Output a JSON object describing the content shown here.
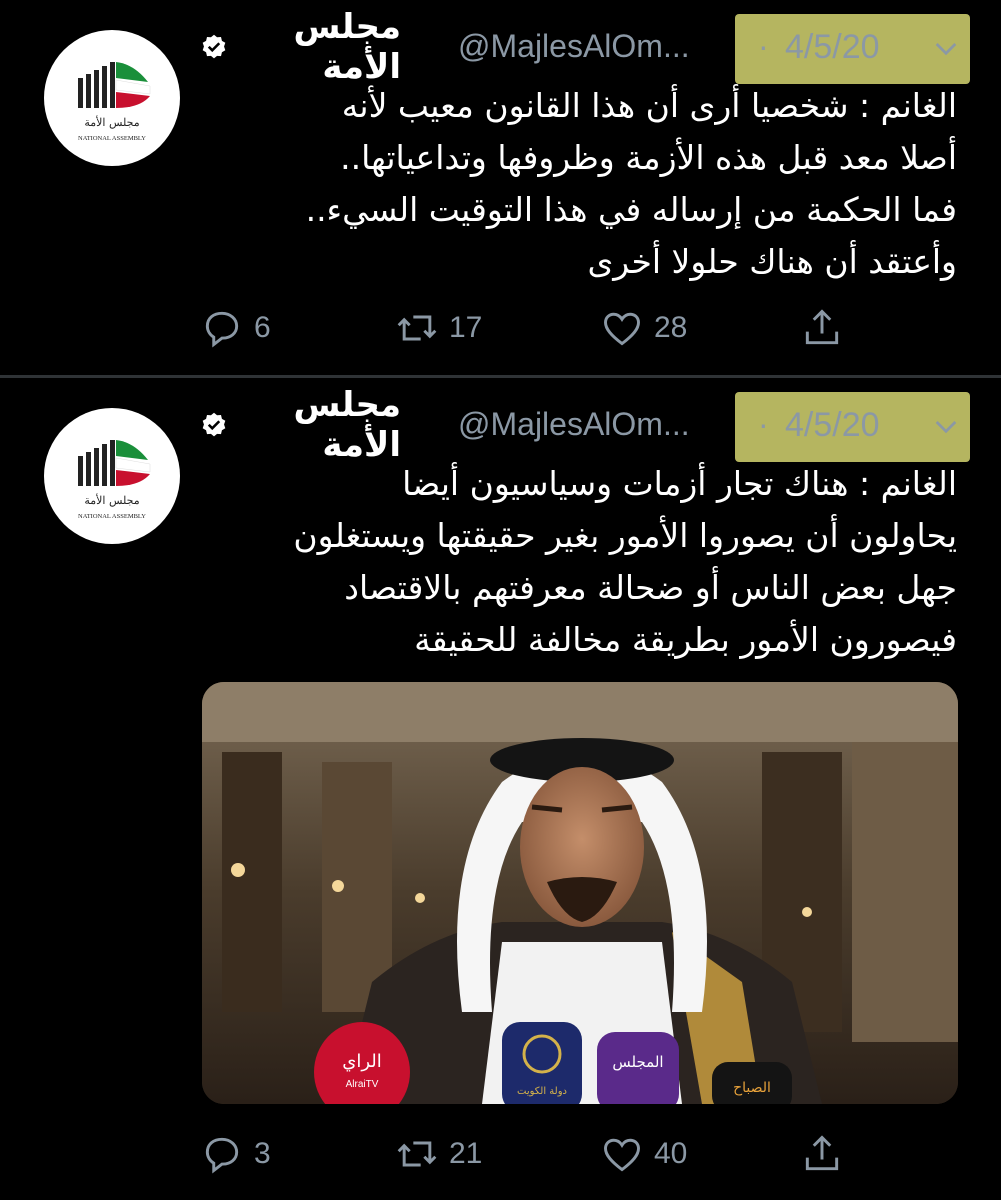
{
  "tweets": [
    {
      "author": {
        "display_name": "مجلس الأمة",
        "handle": "@MajlesAlOm...",
        "verified": true,
        "avatar_caption": "NATIONAL ASSEMBLY"
      },
      "timestamp": "4/5/20",
      "separator": "·",
      "text_lines": [
        "الغانم : شخصيا أرى أن هذا القانون معيب لأنه",
        "أصلا معد قبل هذه الأزمة وظروفها وتداعياتها..",
        "فما الحكمة من إرساله في هذا التوقيت السيء..",
        "وأعتقد أن هناك حلولا أخرى"
      ],
      "counts": {
        "replies": "6",
        "retweets": "17",
        "likes": "28"
      }
    },
    {
      "author": {
        "display_name": "مجلس الأمة",
        "handle": "@MajlesAlOm...",
        "verified": true,
        "avatar_caption": "NATIONAL ASSEMBLY"
      },
      "timestamp": "4/5/20",
      "separator": "·",
      "text_lines": [
        "الغانم : هناك تجار أزمات وسياسيون أيضا",
        "يحاولون أن يصوروا الأمور بغير حقيقتها ويستغلون",
        "جهل بعض الناس أو ضحالة معرفتهم بالاقتصاد",
        "فيصورون الأمور بطريقة مخالفة للحقيقة"
      ],
      "media": {
        "mic_labels": [
          "الراي",
          "AlraiTV",
          "المجلس",
          "الصباح",
          "دولة الكويت"
        ]
      },
      "counts": {
        "replies": "3",
        "retweets": "21",
        "likes": "40"
      }
    }
  ],
  "colors": {
    "background": "#000000",
    "text": "#ffffff",
    "muted": "#8b98a5",
    "divider": "#2f3336",
    "highlight": "#c9c96a"
  },
  "icons": [
    "verified-icon",
    "chevron-down-icon",
    "reply-icon",
    "retweet-icon",
    "like-icon",
    "share-icon"
  ]
}
